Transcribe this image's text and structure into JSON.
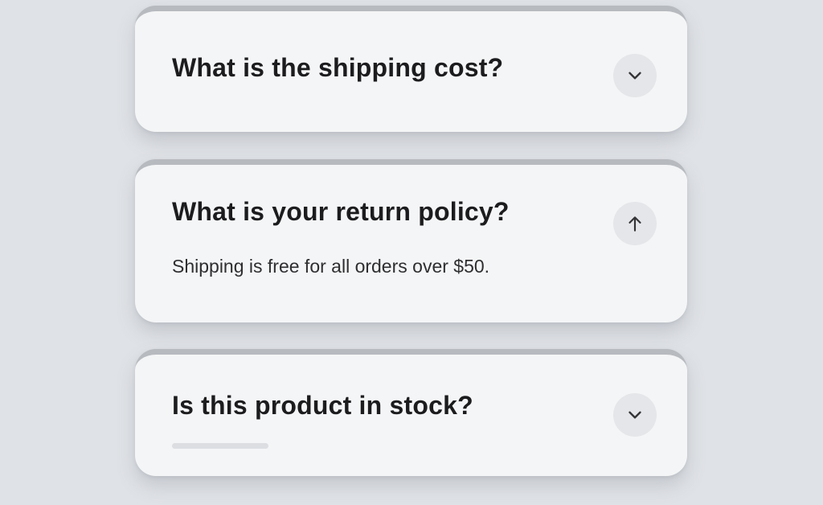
{
  "faq": {
    "items": [
      {
        "question": "What is the shipping cost?",
        "toggle_icon": "chevron-down-icon",
        "expanded": false
      },
      {
        "question": "What is your return policy?",
        "answer": "Shipping is free for all orders over $50.",
        "toggle_icon": "arrow-up-icon",
        "expanded": true
      },
      {
        "question": "Is this product in stock?",
        "toggle_icon": "chevron-down-icon",
        "expanded": false,
        "loading": true
      }
    ]
  },
  "colors": {
    "background": "#dfe2e6",
    "card": "#f4f5f6",
    "card_top_border": "#b7babf",
    "toggle_bg": "#e5e6e9",
    "text_primary": "#1c1c1e",
    "text_secondary": "#2e2e30"
  }
}
